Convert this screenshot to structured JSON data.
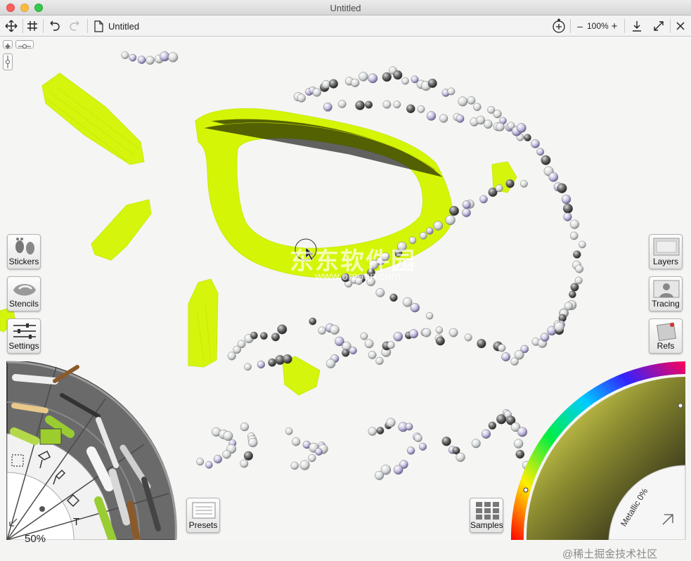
{
  "window": {
    "title": "Untitled"
  },
  "toolbar": {
    "doc_title": "Untitled",
    "zoom_minus": "–",
    "zoom_value": "100%",
    "zoom_plus": "+",
    "icons": [
      "move-icon",
      "grid-icon",
      "undo-icon",
      "redo-icon",
      "document-icon",
      "canvas-rotate-icon",
      "download-icon",
      "fullscreen-icon",
      "close-icon"
    ]
  },
  "left_panel": {
    "stickers_label": "Stickers",
    "stencils_label": "Stencils",
    "settings_label": "Settings"
  },
  "right_panel": {
    "layers_label": "Layers",
    "tracing_label": "Tracing",
    "refs_label": "Refs"
  },
  "bottom": {
    "presets_label": "Presets",
    "samples_label": "Samples",
    "tool_size": "50%",
    "metallic": "Metallic 0%",
    "text_tool_glyph": "T"
  },
  "watermark": {
    "text": "东东软件园",
    "url": "www.orsoon.com",
    "corner": "@稀土掘金技术社区"
  },
  "colors": {
    "paint": "#d4f500",
    "canvas": "#f5f5f3",
    "wheel_panel": "#1a1a1a"
  }
}
